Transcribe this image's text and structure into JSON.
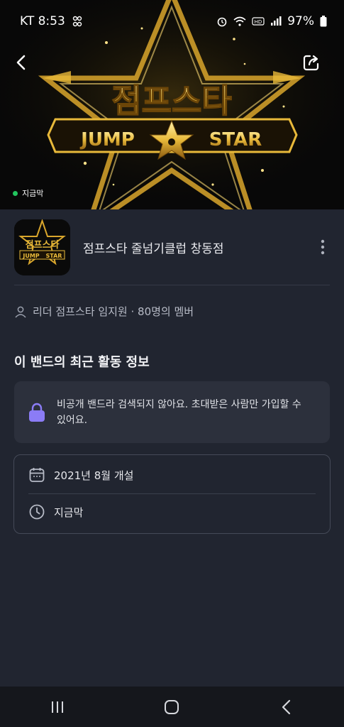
{
  "status_bar": {
    "carrier_time": "KT 8:53",
    "battery": "97%"
  },
  "hero": {
    "logo_korean": "점프스타",
    "logo_left": "JUMP",
    "logo_right": "STAR",
    "live_label": "지금막"
  },
  "band": {
    "name": "점프스타 줄넘기클럽  창동점",
    "thumb_korean": "점프스타",
    "thumb_left": "JUMP",
    "thumb_right": "STAR"
  },
  "members_line": "리더 점프스타  임지원 · 80명의 멤버",
  "section_title": "이 밴드의 최근 활동 정보",
  "private_notice": {
    "line1": "비공개 밴드라 검색되지 않아요. 초대받은 사람만 가입할 수",
    "line2": "있어요."
  },
  "info": {
    "opened": "2021년 8월 개설",
    "last_active": "지금막"
  },
  "colors": {
    "background": "#212530",
    "gold": "#e8b93a",
    "live_dot": "#22c55e",
    "lock_accent": "#8b7cf6"
  },
  "icons": [
    "back-arrow-icon",
    "share-icon",
    "more-vertical-icon",
    "person-icon",
    "lock-icon",
    "calendar-icon",
    "clock-icon",
    "recent-apps-icon",
    "home-icon",
    "nav-back-icon"
  ]
}
